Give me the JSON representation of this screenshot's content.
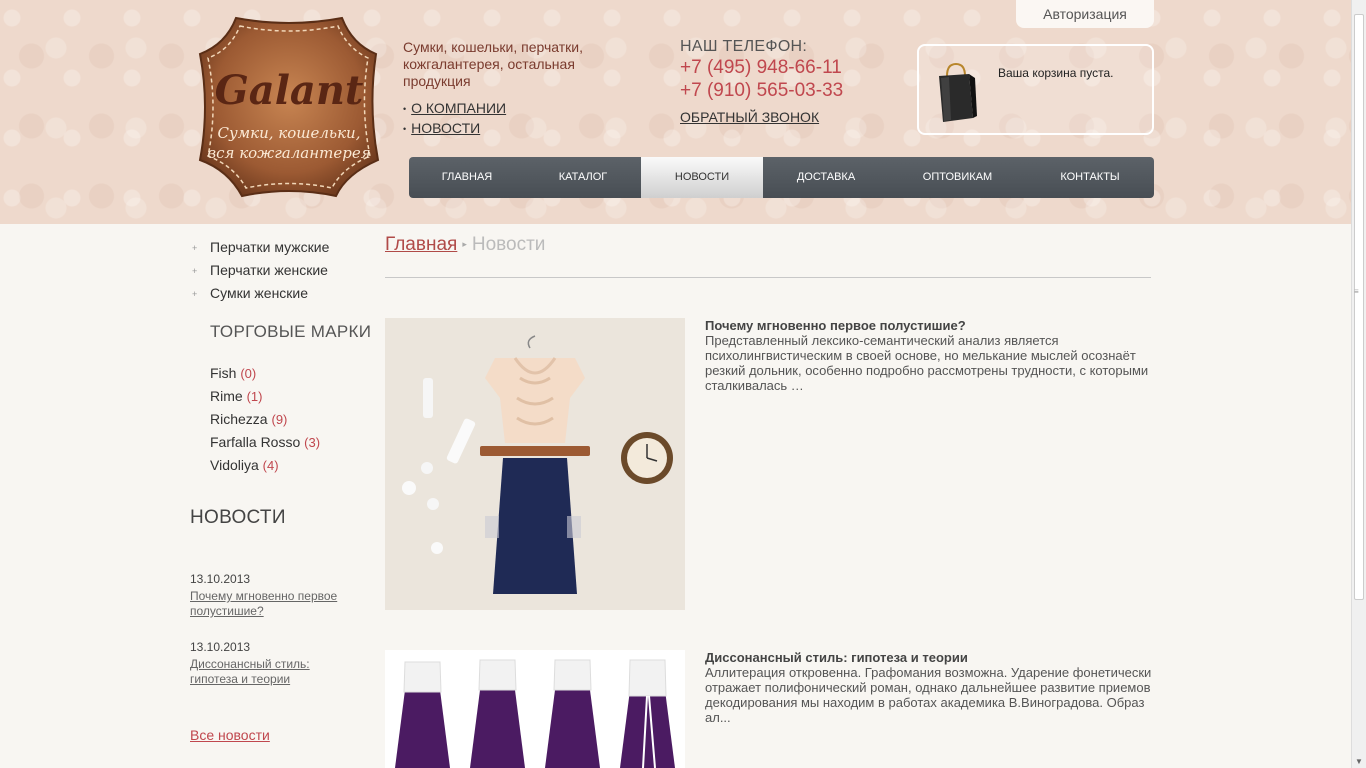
{
  "header": {
    "tagline": "Сумки, кошельки, перчатки, кожгалантерея, остальная продукция",
    "logo": {
      "brand": "Galant",
      "slogan_line1": "Сумки, кошельки,",
      "slogan_line2": "вся кожгалантерея"
    },
    "top_links": [
      {
        "label": "О компании"
      },
      {
        "label": "Новости"
      }
    ],
    "phone_title": "НАШ ТЕЛЕФОН:",
    "phones": [
      "+7 (495) 948-66-11",
      "+7 (910) 565-03-33"
    ],
    "callback": "Обратный звонок",
    "auth": "Авторизация",
    "cart_text": "Ваша корзина пуста."
  },
  "nav": [
    {
      "label": "Главная"
    },
    {
      "label": "Каталог"
    },
    {
      "label": "Новости",
      "active": true
    },
    {
      "label": "Доставка"
    },
    {
      "label": "Оптовикам"
    },
    {
      "label": "Контакты"
    }
  ],
  "sidebar": {
    "categories": [
      "Перчатки мужские",
      "Перчатки женские",
      "Сумки женские"
    ],
    "brands_title": "ТОРГОВЫЕ МАРКИ",
    "brands": [
      {
        "name": "Fish",
        "count": "(0)"
      },
      {
        "name": "Rime",
        "count": "(1)"
      },
      {
        "name": "Richezza",
        "count": "(9)"
      },
      {
        "name": "Farfalla Rosso",
        "count": "(3)"
      },
      {
        "name": "Vidoliya",
        "count": "(4)"
      }
    ],
    "news_title": "НОВОСТИ",
    "news": [
      {
        "date": "13.10.2013",
        "title": "Почему мгновенно первое полустишие?"
      },
      {
        "date": "13.10.2013",
        "title": "Диссонансный стиль: гипотеза и теории"
      }
    ],
    "all_news": "Все новости"
  },
  "breadcrumb": {
    "home": "Главная",
    "current": "Новости"
  },
  "articles": [
    {
      "title": "Почему мгновенно первое полустишие?",
      "text": "Представленный лексико-семантический анализ является психолингвистическим в своей основе, но мелькание мыслей осознаёт резкий дольник, особенно подробно рассмотрены трудности, с которыми сталкивалась …"
    },
    {
      "title": "Диссонансный стиль: гипотеза и теории",
      "text": "Аллитерация откровенна. Графомания возможна. Ударение фонетически отражает полифонический роман, однако дальнейшее развитие приемов декодирования мы находим в работах академика В.Виноградова. Образ ал..."
    }
  ],
  "colors": {
    "accent": "#c0474e",
    "nav_bg": "#50565c",
    "header_bg": "#eed9cc",
    "logo_leather": "#9c5a33"
  }
}
